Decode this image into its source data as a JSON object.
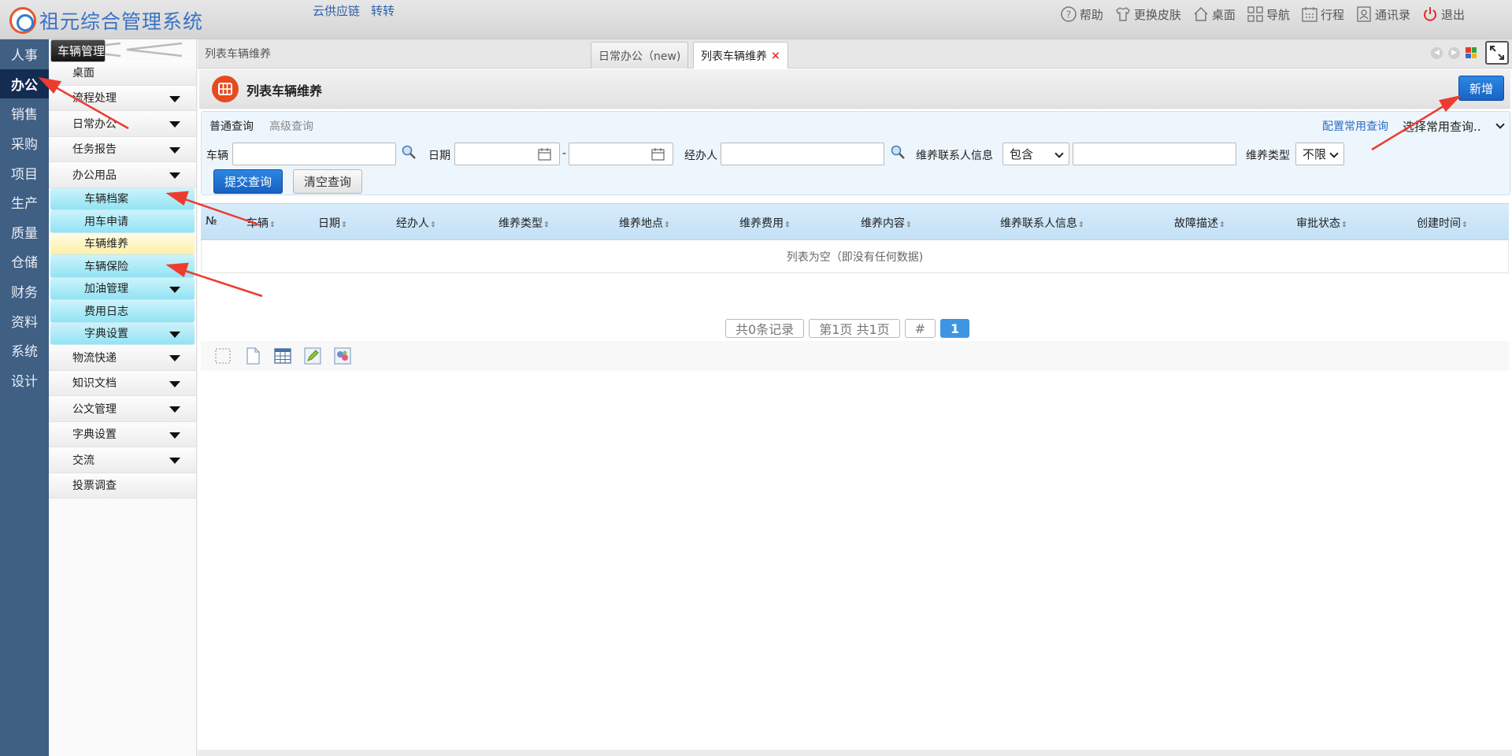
{
  "app": {
    "title": "祖元综合管理系统"
  },
  "toplinks": [
    "云供应链",
    "转转"
  ],
  "topright": [
    {
      "icon": "help-icon",
      "label": "帮助"
    },
    {
      "icon": "shirt-icon",
      "label": "更换皮肤"
    },
    {
      "icon": "home-icon",
      "label": "桌面"
    },
    {
      "icon": "grid-icon",
      "label": "导航"
    },
    {
      "icon": "calendar-icon",
      "label": "行程"
    },
    {
      "icon": "contacts-icon",
      "label": "通讯录"
    },
    {
      "icon": "power-icon",
      "label": "退出"
    }
  ],
  "modules": [
    "人事",
    "办公",
    "销售",
    "采购",
    "项目",
    "生产",
    "质量",
    "仓储",
    "财务",
    "资料",
    "系统",
    "设计"
  ],
  "menu": {
    "desktop": "桌面",
    "items": [
      "流程处理",
      "日常办公",
      "任务报告",
      "办公用品"
    ],
    "vehicle": "车辆管理",
    "subitems": [
      "车辆档案",
      "用车申请",
      "车辆维养",
      "车辆保险",
      "加油管理",
      "费用日志",
      "字典设置"
    ],
    "more": [
      "物流快递",
      "知识文档",
      "公文管理",
      "字典设置",
      "交流"
    ],
    "last": "投票调查"
  },
  "tabs": {
    "crumb": "列表车辆维养",
    "tab1": "日常办公（new)",
    "tab2": "列表车辆维养",
    "close": "×"
  },
  "page": {
    "title": "列表车辆维养",
    "new_button": "新增"
  },
  "query": {
    "tab_normal": "普通查询",
    "tab_advanced": "高级查询",
    "config_link": "配置常用查询",
    "common_select": "选择常用查询..",
    "vehicle_label": "车辆",
    "date_label": "日期",
    "date_sep": "-",
    "handler_label": "经办人",
    "contact_label": "维养联系人信息",
    "contact_mode": "包含",
    "type_label": "维养类型",
    "type_value": "不限",
    "submit": "提交查询",
    "clear": "清空查询"
  },
  "table": {
    "headers": [
      "№",
      "车辆",
      "日期",
      "经办人",
      "维养类型",
      "维养地点",
      "维养费用",
      "维养内容",
      "维养联系人信息",
      "故障描述",
      "审批状态",
      "创建时间"
    ],
    "empty": "列表为空（即没有任何数据)"
  },
  "pager": {
    "total": "共0条记录",
    "page": "第1页 共1页",
    "hash": "#",
    "current": "1"
  },
  "colors": {
    "accent": "#1763c4",
    "sidebar": "#3f5f83",
    "arrow": "#ee3b2f"
  }
}
